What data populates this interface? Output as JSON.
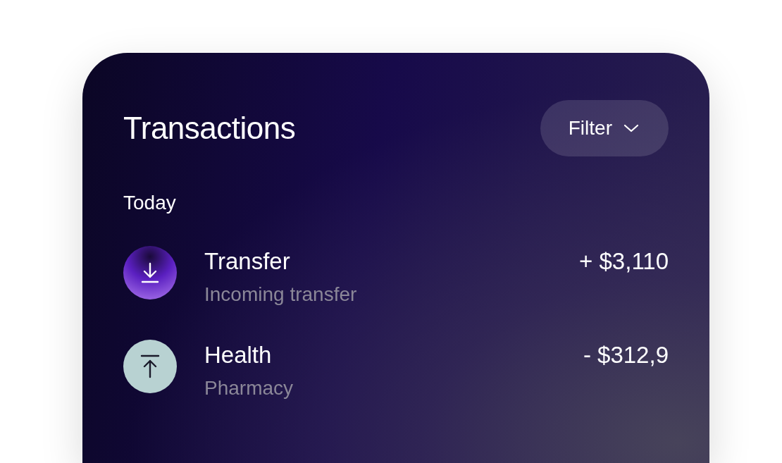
{
  "card": {
    "title": "Transactions",
    "filter": {
      "label": "Filter"
    },
    "section": "Today",
    "transactions": [
      {
        "kind": "incoming",
        "title": "Transfer",
        "subtitle": "Incoming transfer",
        "amount": "+ $3,110"
      },
      {
        "kind": "outgoing",
        "title": "Health",
        "subtitle": "Pharmacy",
        "amount": "- $312,9"
      }
    ]
  }
}
